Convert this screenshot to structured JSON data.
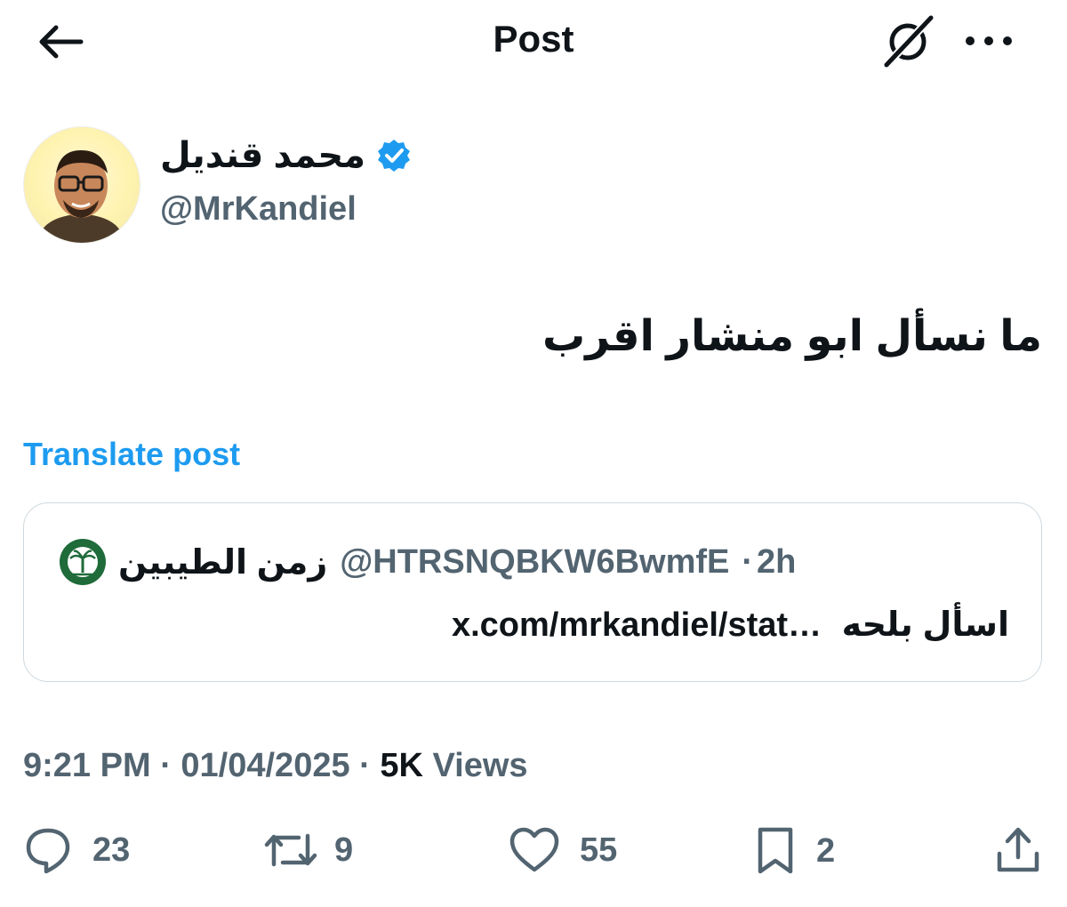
{
  "header": {
    "title": "Post",
    "back_icon": "arrow-left-icon",
    "grok_icon": "grok-icon",
    "more_icon": "more-horizontal-icon"
  },
  "author": {
    "display_name": "محمد قنديل",
    "handle": "@MrKandiel",
    "verified": true,
    "verified_color": "#1d9bf0"
  },
  "post": {
    "text": "ما نسأل ابو منشار اقرب",
    "translate_label": "Translate post"
  },
  "quote": {
    "display_name": "زمن الطيبين",
    "handle": "@HTRSNQBKW6BwmfE",
    "separator": "·",
    "time": "2h",
    "text_arabic": "اسأل بلحه",
    "text_link": "x.com/mrkandiel/stat…"
  },
  "meta": {
    "time": "9:21 PM",
    "separator": "·",
    "date": "01/04/2025",
    "views_count": "5K",
    "views_label": "Views"
  },
  "actions": {
    "replies": "23",
    "reposts": "9",
    "likes": "55",
    "bookmarks": "2"
  },
  "colors": {
    "accent": "#1d9bf0",
    "text_primary": "#0f1419",
    "text_secondary": "#536471",
    "border": "#cfd9de"
  }
}
